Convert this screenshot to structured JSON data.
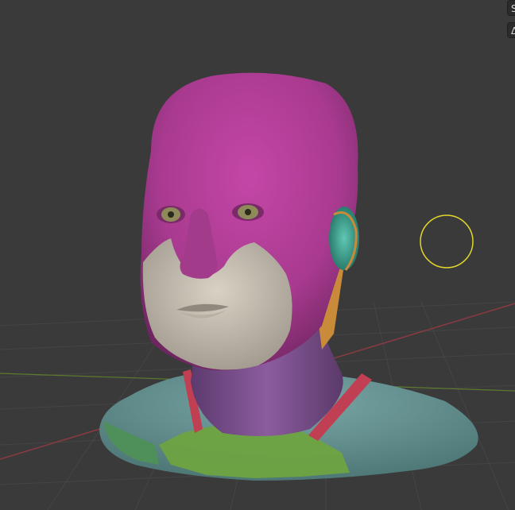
{
  "viewport": {
    "overlay_buttons": [
      {
        "glyph": "S",
        "icon": "view-toggle-icon"
      },
      {
        "glyph": "Δ",
        "icon": "mesh-overlay-icon"
      }
    ]
  },
  "colors": {
    "background": "#3a3a3a",
    "grid": "#454545",
    "x_axis": "#8a3a42",
    "y_axis": "#5c7a2f",
    "face_set_head": "#b13f97",
    "skin": "#bdb5a8",
    "face_set_neck": "#7d4f8f",
    "face_set_shoulders": "#5f8e8f",
    "face_set_chest": "#6ea341",
    "face_set_ear": "#3d9e8c",
    "face_set_jaw": "#c98a3a",
    "face_set_strap": "#c13f52",
    "brush_cursor": "#e3d62a"
  }
}
